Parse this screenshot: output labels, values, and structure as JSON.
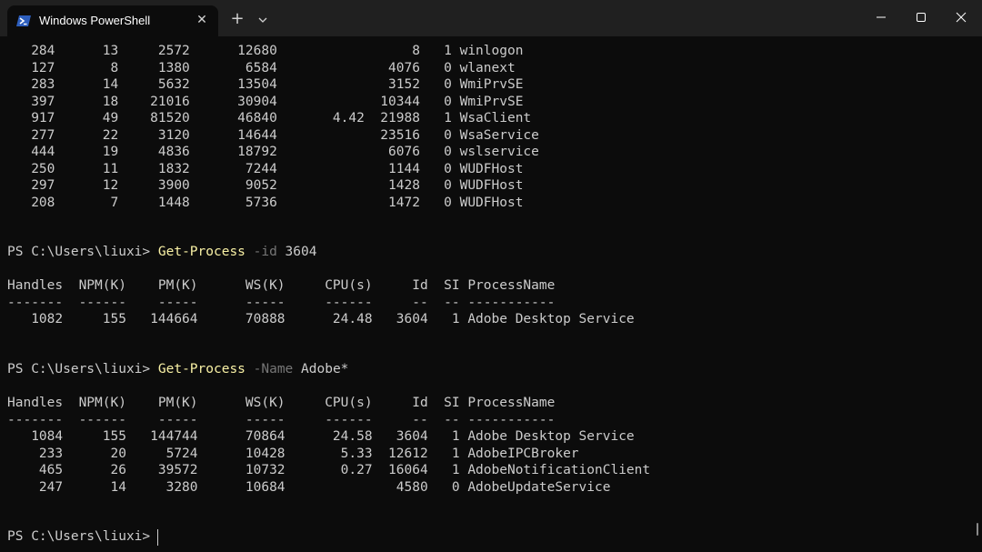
{
  "window": {
    "tab_title": "Windows PowerShell",
    "tab_icon": "powershell-icon",
    "close_tab_glyph": "✕",
    "new_tab_glyph": "+",
    "minimize_icon": "minimize-icon",
    "maximize_icon": "maximize-icon",
    "close_icon": "close-icon"
  },
  "terminal": {
    "upper_rows": [
      "   284      13     2572      12680                 8   1 winlogon",
      "   127       8     1380       6584              4076   0 wlanext",
      "   283      14     5632      13504              3152   0 WmiPrvSE",
      "   397      18    21016      30904             10344   0 WmiPrvSE",
      "   917      49    81520      46840       4.42  21988   1 WsaClient",
      "   277      22     3120      14644             23516   0 WsaService",
      "   444      19     4836      18792              6076   0 wslservice",
      "   250      11     1832       7244              1144   0 WUDFHost",
      "   297      12     3900       9052              1428   0 WUDFHost",
      "   208       7     1448       5736              1472   0 WUDFHost"
    ],
    "prompt": "PS C:\\Users\\liuxi> ",
    "command1": {
      "cmdlet": "Get-Process",
      "param": " -id",
      "arg": " 3604"
    },
    "header": "Handles  NPM(K)    PM(K)      WS(K)     CPU(s)     Id  SI ProcessName",
    "separator": "-------  ------    -----      -----     ------     --  -- -----------",
    "result1": [
      "   1082     155   144664      70888      24.48   3604   1 Adobe Desktop Service"
    ],
    "command2": {
      "cmdlet": "Get-Process",
      "param": " -Name",
      "arg": " Adobe*"
    },
    "result2": [
      "   1084     155   144744      70864      24.58   3604   1 Adobe Desktop Service",
      "    233      20     5724      10428       5.33  12612   1 AdobeIPCBroker",
      "    465      26    39572      10732       0.27  16064   1 AdobeNotificationClient",
      "    247      14     3280      10684              4580   0 AdobeUpdateService"
    ]
  }
}
